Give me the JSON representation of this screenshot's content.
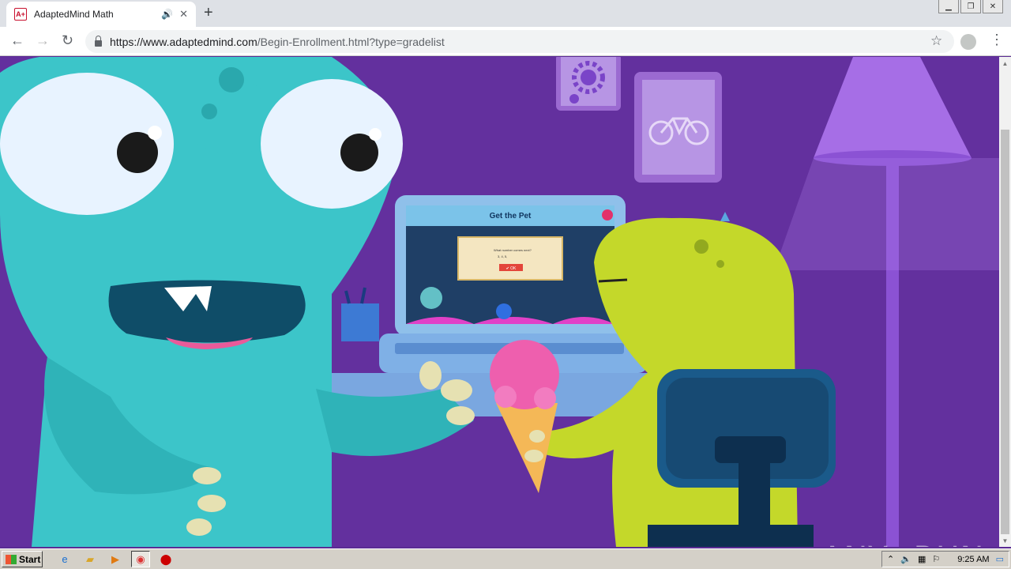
{
  "browser": {
    "tab": {
      "title": "AdaptedMind Math",
      "favicon_text": "A+"
    },
    "url": {
      "host": "https://www.adaptedmind.com",
      "path": "/Begin-Enrollment.html?type=gradelist"
    }
  },
  "scene": {
    "laptop_title": "Get the Pet",
    "dialog_question": "What number comes next?",
    "dialog_sequence": "3, 4, 5,",
    "dialog_button": "✔ OK"
  },
  "watermark": "ANY▷RUN",
  "taskbar": {
    "start_label": "Start",
    "clock": "9:25 AM"
  },
  "colors": {
    "background": "#5b2b94",
    "monster_blue": "#3cc5c9",
    "monster_green": "#c4d82a"
  }
}
